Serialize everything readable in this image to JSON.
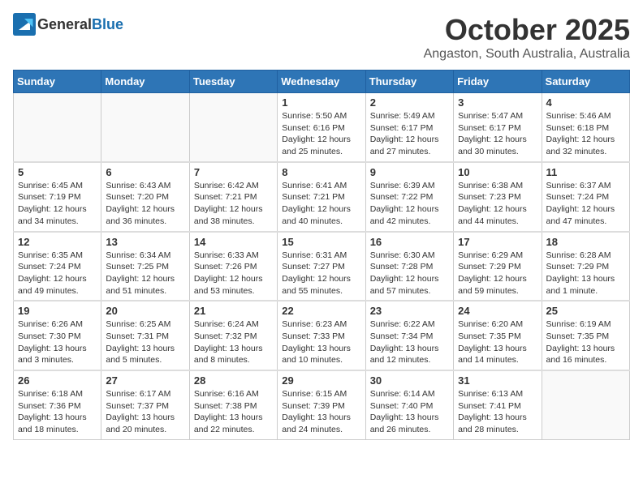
{
  "header": {
    "logo_general": "General",
    "logo_blue": "Blue",
    "month": "October 2025",
    "location": "Angaston, South Australia, Australia"
  },
  "days_of_week": [
    "Sunday",
    "Monday",
    "Tuesday",
    "Wednesday",
    "Thursday",
    "Friday",
    "Saturday"
  ],
  "weeks": [
    [
      {
        "day": "",
        "info": ""
      },
      {
        "day": "",
        "info": ""
      },
      {
        "day": "",
        "info": ""
      },
      {
        "day": "1",
        "info": "Sunrise: 5:50 AM\nSunset: 6:16 PM\nDaylight: 12 hours\nand 25 minutes."
      },
      {
        "day": "2",
        "info": "Sunrise: 5:49 AM\nSunset: 6:17 PM\nDaylight: 12 hours\nand 27 minutes."
      },
      {
        "day": "3",
        "info": "Sunrise: 5:47 AM\nSunset: 6:17 PM\nDaylight: 12 hours\nand 30 minutes."
      },
      {
        "day": "4",
        "info": "Sunrise: 5:46 AM\nSunset: 6:18 PM\nDaylight: 12 hours\nand 32 minutes."
      }
    ],
    [
      {
        "day": "5",
        "info": "Sunrise: 6:45 AM\nSunset: 7:19 PM\nDaylight: 12 hours\nand 34 minutes."
      },
      {
        "day": "6",
        "info": "Sunrise: 6:43 AM\nSunset: 7:20 PM\nDaylight: 12 hours\nand 36 minutes."
      },
      {
        "day": "7",
        "info": "Sunrise: 6:42 AM\nSunset: 7:21 PM\nDaylight: 12 hours\nand 38 minutes."
      },
      {
        "day": "8",
        "info": "Sunrise: 6:41 AM\nSunset: 7:21 PM\nDaylight: 12 hours\nand 40 minutes."
      },
      {
        "day": "9",
        "info": "Sunrise: 6:39 AM\nSunset: 7:22 PM\nDaylight: 12 hours\nand 42 minutes."
      },
      {
        "day": "10",
        "info": "Sunrise: 6:38 AM\nSunset: 7:23 PM\nDaylight: 12 hours\nand 44 minutes."
      },
      {
        "day": "11",
        "info": "Sunrise: 6:37 AM\nSunset: 7:24 PM\nDaylight: 12 hours\nand 47 minutes."
      }
    ],
    [
      {
        "day": "12",
        "info": "Sunrise: 6:35 AM\nSunset: 7:24 PM\nDaylight: 12 hours\nand 49 minutes."
      },
      {
        "day": "13",
        "info": "Sunrise: 6:34 AM\nSunset: 7:25 PM\nDaylight: 12 hours\nand 51 minutes."
      },
      {
        "day": "14",
        "info": "Sunrise: 6:33 AM\nSunset: 7:26 PM\nDaylight: 12 hours\nand 53 minutes."
      },
      {
        "day": "15",
        "info": "Sunrise: 6:31 AM\nSunset: 7:27 PM\nDaylight: 12 hours\nand 55 minutes."
      },
      {
        "day": "16",
        "info": "Sunrise: 6:30 AM\nSunset: 7:28 PM\nDaylight: 12 hours\nand 57 minutes."
      },
      {
        "day": "17",
        "info": "Sunrise: 6:29 AM\nSunset: 7:29 PM\nDaylight: 12 hours\nand 59 minutes."
      },
      {
        "day": "18",
        "info": "Sunrise: 6:28 AM\nSunset: 7:29 PM\nDaylight: 13 hours\nand 1 minute."
      }
    ],
    [
      {
        "day": "19",
        "info": "Sunrise: 6:26 AM\nSunset: 7:30 PM\nDaylight: 13 hours\nand 3 minutes."
      },
      {
        "day": "20",
        "info": "Sunrise: 6:25 AM\nSunset: 7:31 PM\nDaylight: 13 hours\nand 5 minutes."
      },
      {
        "day": "21",
        "info": "Sunrise: 6:24 AM\nSunset: 7:32 PM\nDaylight: 13 hours\nand 8 minutes."
      },
      {
        "day": "22",
        "info": "Sunrise: 6:23 AM\nSunset: 7:33 PM\nDaylight: 13 hours\nand 10 minutes."
      },
      {
        "day": "23",
        "info": "Sunrise: 6:22 AM\nSunset: 7:34 PM\nDaylight: 13 hours\nand 12 minutes."
      },
      {
        "day": "24",
        "info": "Sunrise: 6:20 AM\nSunset: 7:35 PM\nDaylight: 13 hours\nand 14 minutes."
      },
      {
        "day": "25",
        "info": "Sunrise: 6:19 AM\nSunset: 7:35 PM\nDaylight: 13 hours\nand 16 minutes."
      }
    ],
    [
      {
        "day": "26",
        "info": "Sunrise: 6:18 AM\nSunset: 7:36 PM\nDaylight: 13 hours\nand 18 minutes."
      },
      {
        "day": "27",
        "info": "Sunrise: 6:17 AM\nSunset: 7:37 PM\nDaylight: 13 hours\nand 20 minutes."
      },
      {
        "day": "28",
        "info": "Sunrise: 6:16 AM\nSunset: 7:38 PM\nDaylight: 13 hours\nand 22 minutes."
      },
      {
        "day": "29",
        "info": "Sunrise: 6:15 AM\nSunset: 7:39 PM\nDaylight: 13 hours\nand 24 minutes."
      },
      {
        "day": "30",
        "info": "Sunrise: 6:14 AM\nSunset: 7:40 PM\nDaylight: 13 hours\nand 26 minutes."
      },
      {
        "day": "31",
        "info": "Sunrise: 6:13 AM\nSunset: 7:41 PM\nDaylight: 13 hours\nand 28 minutes."
      },
      {
        "day": "",
        "info": ""
      }
    ]
  ]
}
